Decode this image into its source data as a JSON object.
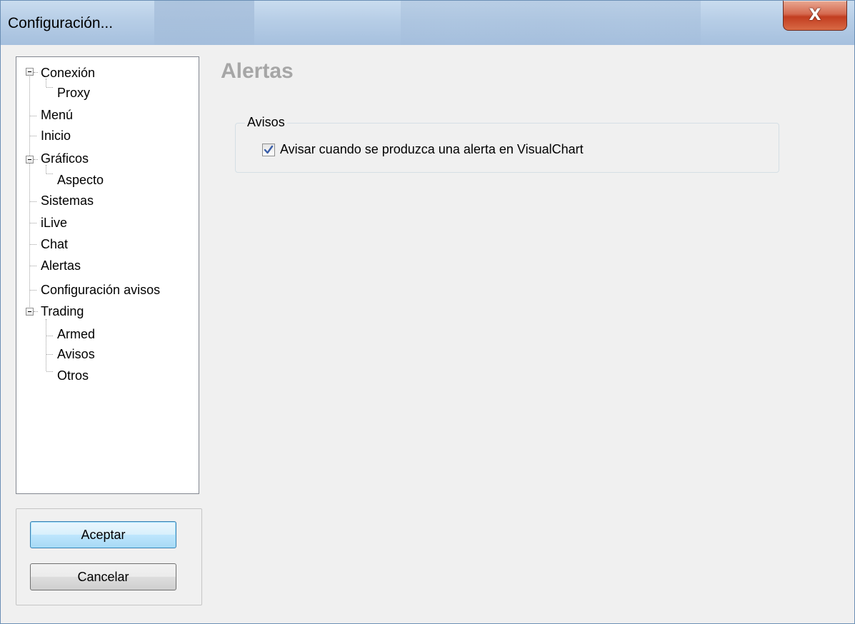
{
  "window": {
    "title": "Configuración...",
    "close_glyph": "X"
  },
  "tree": {
    "items": [
      {
        "label": "Conexión",
        "icon": "minus-icon"
      },
      {
        "label": "Proxy"
      },
      {
        "label": "Menú"
      },
      {
        "label": "Inicio"
      },
      {
        "label": "Gráficos",
        "icon": "minus-icon"
      },
      {
        "label": "Aspecto"
      },
      {
        "label": "Sistemas"
      },
      {
        "label": "iLive"
      },
      {
        "label": "Chat"
      },
      {
        "label": "Alertas",
        "selected": true
      },
      {
        "label": "Configuración avisos"
      },
      {
        "label": "Trading",
        "icon": "minus-icon"
      },
      {
        "label": "Armed"
      },
      {
        "label": "Avisos"
      },
      {
        "label": "Otros"
      }
    ]
  },
  "buttons": {
    "accept": "Aceptar",
    "cancel": "Cancelar"
  },
  "content": {
    "title": "Alertas",
    "group": {
      "legend": "Avisos",
      "checkbox_label": "Avisar cuando se produzca una alerta en VisualChart",
      "checked": true
    }
  },
  "colors": {
    "section_title": "#a6a6a6",
    "close_button": "#c23d20",
    "check": "#3a5ea8"
  }
}
